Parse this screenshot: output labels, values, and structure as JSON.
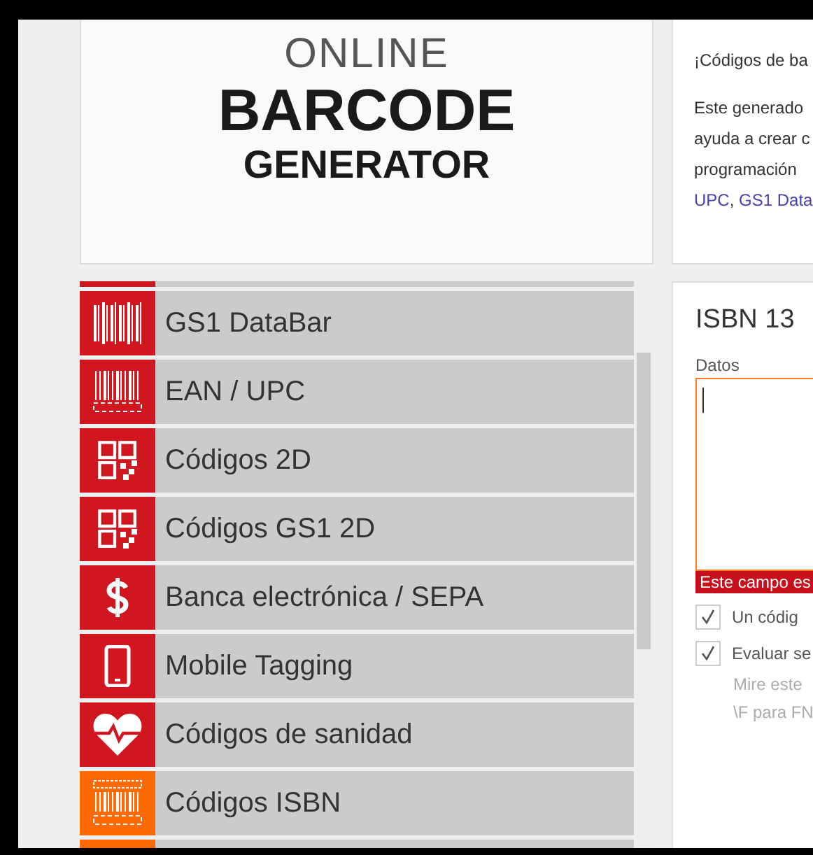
{
  "logo": {
    "line_1": "ONLINE",
    "line_2": "BARCODE",
    "line_3": "GENERATOR"
  },
  "intro": {
    "lead": "¡Códigos de ba",
    "paragraph": [
      "Este generado",
      "ayuda a crear c",
      "programación"
    ],
    "links": [
      "UPC",
      ", ",
      "GS1 Data"
    ]
  },
  "sidebar": {
    "items": [
      {
        "label": "GS1 DataBar",
        "kind": "databar",
        "color": "#d0161e"
      },
      {
        "label": "EAN / UPC",
        "kind": "barcode",
        "color": "#d0161e"
      },
      {
        "label": "Códigos 2D",
        "kind": "qr",
        "color": "#d0161e"
      },
      {
        "label": "Códigos GS1 2D",
        "kind": "qr",
        "color": "#d0161e"
      },
      {
        "label": "Banca electrónica / SEPA",
        "kind": "dollar",
        "color": "#d0161e"
      },
      {
        "label": "Mobile Tagging",
        "kind": "phone",
        "color": "#d0161e"
      },
      {
        "label": "Códigos de sanidad",
        "kind": "heart",
        "color": "#d0161e"
      },
      {
        "label": "Códigos ISBN",
        "kind": "isbn",
        "color": "#ff6a00"
      }
    ]
  },
  "form": {
    "title": "ISBN 13",
    "field_label": "Datos",
    "error": "Este campo es",
    "options": [
      {
        "label": "Un códig",
        "checked": true
      },
      {
        "label": "Evaluar se",
        "checked": true
      }
    ],
    "help": [
      "Mire este",
      "\\F para FN"
    ]
  }
}
